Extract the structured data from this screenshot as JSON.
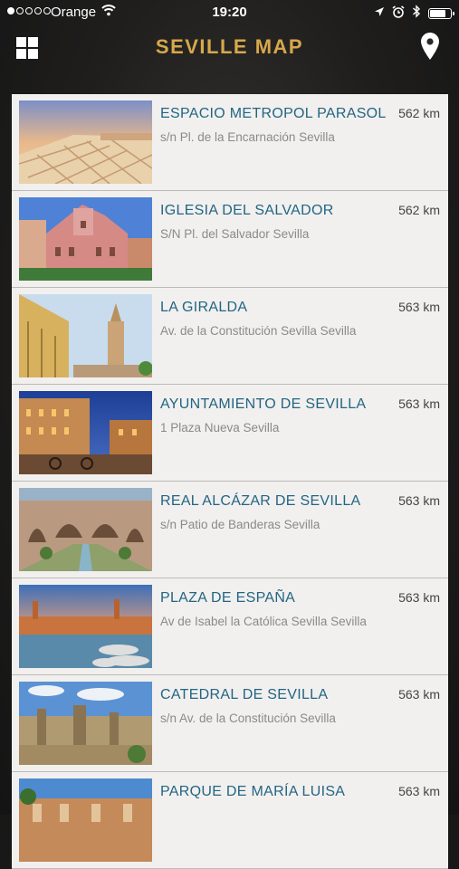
{
  "status": {
    "carrier": "Orange",
    "time": "19:20",
    "battery_level": 0.8,
    "signal_bars": 1
  },
  "header": {
    "title": "SEVILLE MAP",
    "menu_icon": "grid-icon",
    "map_icon": "location-pin-icon",
    "title_color": "#d7a84a"
  },
  "places": [
    {
      "name": "ESPACIO METROPOL PARASOL",
      "address": "s/n Pl. de la Encarnación Sevilla",
      "distance": "562 km"
    },
    {
      "name": "IGLESIA DEL SALVADOR",
      "address": "S/N Pl. del Salvador Sevilla",
      "distance": "562 km"
    },
    {
      "name": "LA GIRALDA",
      "address": "Av. de la Constitución Sevilla Sevilla",
      "distance": "563 km"
    },
    {
      "name": "AYUNTAMIENTO DE SEVILLA",
      "address": "1 Plaza Nueva Sevilla",
      "distance": "563 km"
    },
    {
      "name": "REAL ALCÁZAR DE SEVILLA",
      "address": "s/n Patio de Banderas Sevilla",
      "distance": "563 km"
    },
    {
      "name": "PLAZA DE ESPAÑA",
      "address": "Av de Isabel la Católica Sevilla Sevilla",
      "distance": "563 km"
    },
    {
      "name": "CATEDRAL DE SEVILLA",
      "address": "s/n Av. de la Constitución Sevilla",
      "distance": "563 km"
    },
    {
      "name": "PARQUE DE MARÍA LUISA",
      "address": "",
      "distance": "563 km"
    }
  ]
}
